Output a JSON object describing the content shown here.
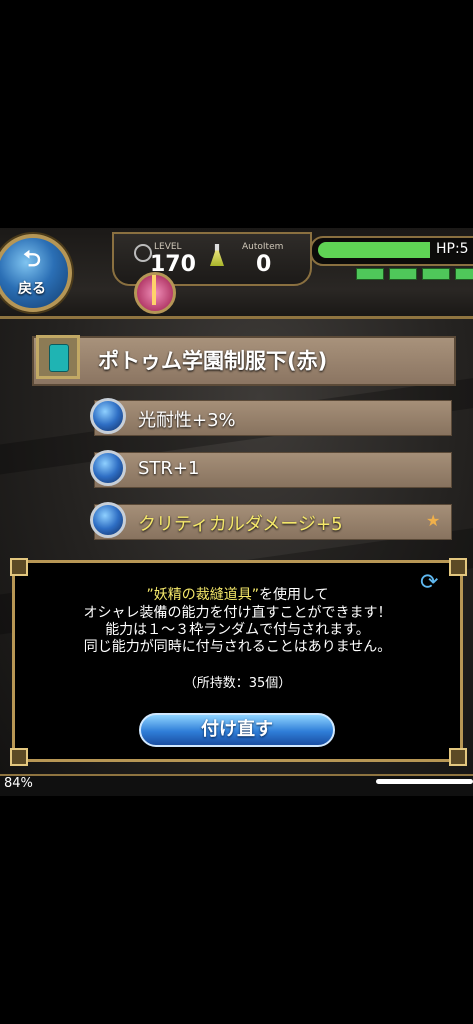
{
  "header": {
    "back_label": "戻る",
    "level_tag": "LEVEL",
    "level_value": "170",
    "auto_tag": "AutoItem",
    "auto_value": "0",
    "hp_label": "HP:5",
    "hp_fill_fraction": 0.72
  },
  "item": {
    "name": "ポトゥム学園制服下(赤)"
  },
  "abilities": [
    {
      "text": "光耐性+3%",
      "color": "white"
    },
    {
      "text": "STR+1",
      "color": "white"
    },
    {
      "text": "クリティカルダメージ+5",
      "color": "gold",
      "starred": true
    }
  ],
  "dialog": {
    "tool_name": "”妖精の裁縫道具”",
    "line1_suffix": "を使用して",
    "line2": "オシャレ装備の能力を付け直すことができます！",
    "line3": "能力は１～３枠ランダムで付与されます。",
    "line4": "同じ能力が同時に付与されることはありません。",
    "count": "（所持数：35個）",
    "button_label": "付け直す"
  },
  "footer": {
    "percent": "84%"
  },
  "colors": {
    "accent_gold": "#b89755",
    "highlight_yellow": "#f5e86a",
    "hp_green": "#5fd455",
    "button_blue": "#2f7ed8"
  }
}
